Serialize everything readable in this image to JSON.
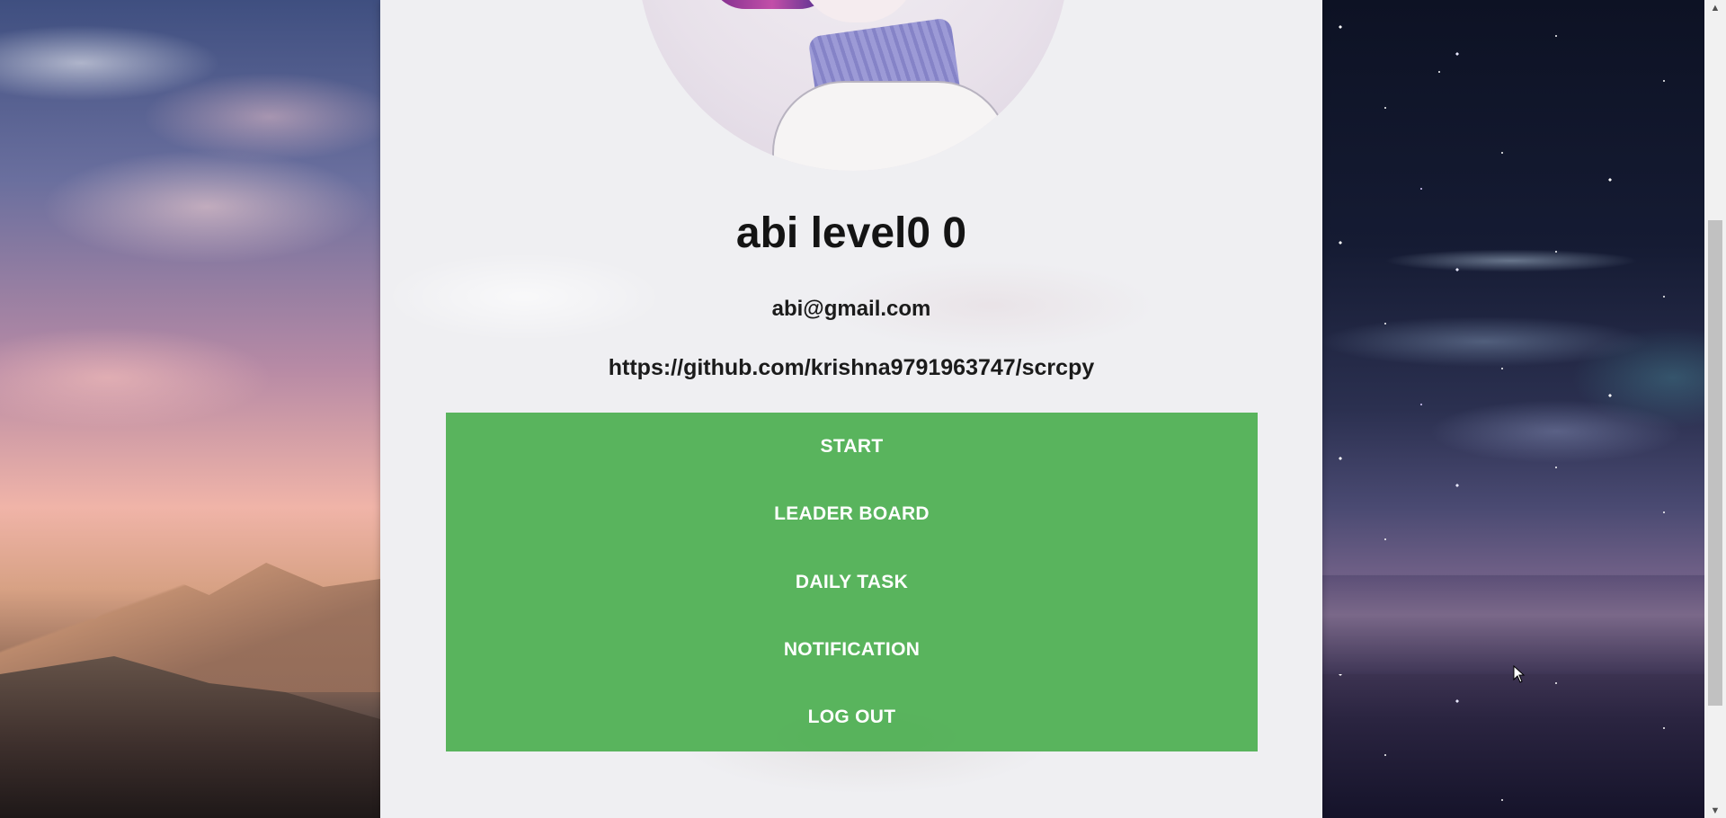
{
  "profile": {
    "name": "abi level0 0",
    "email": "abi@gmail.com",
    "link": "https://github.com/krishna9791963747/scrcpy"
  },
  "menu": {
    "items": [
      "START",
      "LEADER BOARD",
      "DAILY TASK",
      "NOTIFICATION",
      "LOG OUT"
    ]
  },
  "colors": {
    "menu_bg": "#4CAF50",
    "menu_text": "#FFFFFF",
    "panel_bg": "#EFEFF2"
  },
  "icons": {
    "scroll_up": "chevron-up-icon",
    "scroll_down": "chevron-down-icon",
    "cursor": "mouse-pointer-icon"
  }
}
